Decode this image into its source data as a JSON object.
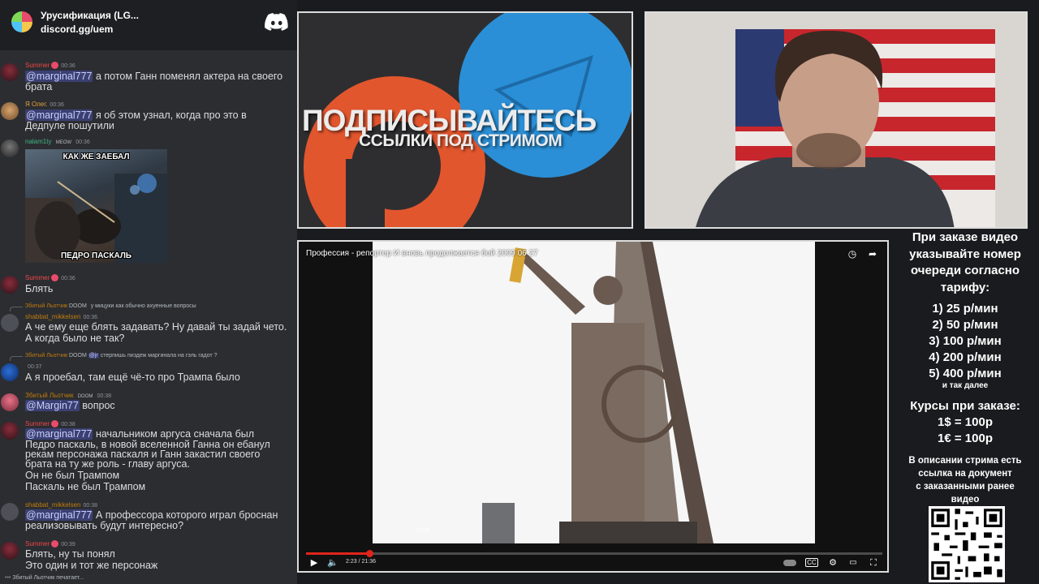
{
  "server": {
    "name": "Урусификация (LG...",
    "invite": "discord.gg/uem"
  },
  "chat": {
    "messages": [
      {
        "user": "Summer",
        "time": "00:36",
        "lines": [
          {
            "mention": "@marginal777",
            "text": " а потом Ганн поменял актера на своего"
          },
          {
            "text": "брата"
          }
        ]
      },
      {
        "user": "Я Олег.",
        "time": "00:36",
        "lines": [
          {
            "mention": "@marginal777",
            "text": " я об этом узнал, когда про это в"
          },
          {
            "text": "Дедпуле пошутили"
          }
        ]
      },
      {
        "user": "nalam1ty",
        "tag": "MEOW",
        "time": "00:36",
        "meme_top": "КАК ЖЕ ЗАЕБАЛ",
        "meme_bottom": "ПЕДРО ПАСКАЛЬ"
      },
      {
        "user": "Summer",
        "time": "00:36",
        "lines": [
          {
            "text": "Блять"
          }
        ]
      },
      {
        "reply_user": "Збитый Льотчик",
        "reply_tag": "DOOM",
        "reply_text": "у мицуки как обычно ахуенные вопросы",
        "user": "shabbat_mikkelsen",
        "time": "00:36",
        "lines": [
          {
            "text": "А че ему еще блять задавать? Ну давай ты задай чето."
          },
          {
            "text": "А когда было не так?"
          }
        ]
      },
      {
        "reply_user": "Збитый Льотчик",
        "reply_tag": "DOOM",
        "reply_mention": "@jr",
        "reply_text": "стерпишь пиздеж маргинала на гэль гадот ?",
        "user": "",
        "time": "00:37",
        "lines": [
          {
            "text": "А я проебал, там ещё чё-то про Трампа было"
          }
        ]
      },
      {
        "user": "Збитый Льотчик",
        "tag": "DOOM",
        "time": "00:38",
        "lines": [
          {
            "mention": "@Margin77",
            "text": " вопрос"
          }
        ]
      },
      {
        "user": "Summer",
        "time": "00:38",
        "lines": [
          {
            "mention": "@marginal777",
            "text": " начальником аргуса сначала был"
          },
          {
            "text": "Педро паскаль, в новой вселенной Ганна он ебанул"
          },
          {
            "text": "рекам персонажа паскаля и Ганн закастил своего"
          },
          {
            "text": "брата на ту же роль - главу аргуса."
          },
          {
            "text": "Он не был Трампом"
          },
          {
            "text": "Паскаль не был Трампом"
          }
        ]
      },
      {
        "user": "shabbat_mikkelsen",
        "time": "00:38",
        "lines": [
          {
            "mention": "@marginal777",
            "text": " А профессора которого играл броснан"
          },
          {
            "text": "реализовывать будут интересно?"
          }
        ]
      },
      {
        "user": "Summer",
        "time": "00:39",
        "lines": [
          {
            "text": "Блять, ну ты понял"
          },
          {
            "text": "Это один и тот же персонаж"
          }
        ]
      }
    ],
    "typing": "Збитый Льотчик печатает..."
  },
  "promo": {
    "title": "ПОДПИСЫВАЙТЕСЬ",
    "subtitle": "ССЫЛКИ ПОД СТРИМОМ"
  },
  "player": {
    "title": "Профессия - репортер И вновь продолжается бой 2009 06 27",
    "time_current": "2:23",
    "time_total": "21:36",
    "progress": 0.11,
    "time_readout": "2:23 / 21:36",
    "channel_logo": "НТВ",
    "icons": [
      "clock-icon",
      "share-icon",
      "play-icon",
      "volume-icon",
      "autoplay-toggle",
      "subtitles-icon",
      "settings-icon",
      "cast-icon",
      "fullscreen-icon"
    ]
  },
  "info": {
    "order_note": [
      "При заказе видео",
      "указывайте номер",
      "очереди согласно",
      "тарифу:"
    ],
    "prices": [
      "1) 25 р/мин",
      "2) 50 р/мин",
      "3) 100 р/мин",
      "4) 200 р/мин",
      "5) 400 р/мин"
    ],
    "and_so_on": "и так далее",
    "rates_title": "Курсы при заказе:",
    "rate_usd": "1$ = 100р",
    "rate_eur": "1€ = 100р",
    "desc_note": [
      "В описании стрима есть",
      "ссылка на документ",
      "с заказанными ранее",
      "видео"
    ]
  },
  "colors": {
    "discord_bg": "#2b2d31",
    "username_summer": "#f04747",
    "username_shabbat": "#c27c0e",
    "mention": "#c9cdfb",
    "progress": "#e0251a",
    "boosty_orange": "#e2562e",
    "telegram_blue": "#2a8fd6"
  }
}
